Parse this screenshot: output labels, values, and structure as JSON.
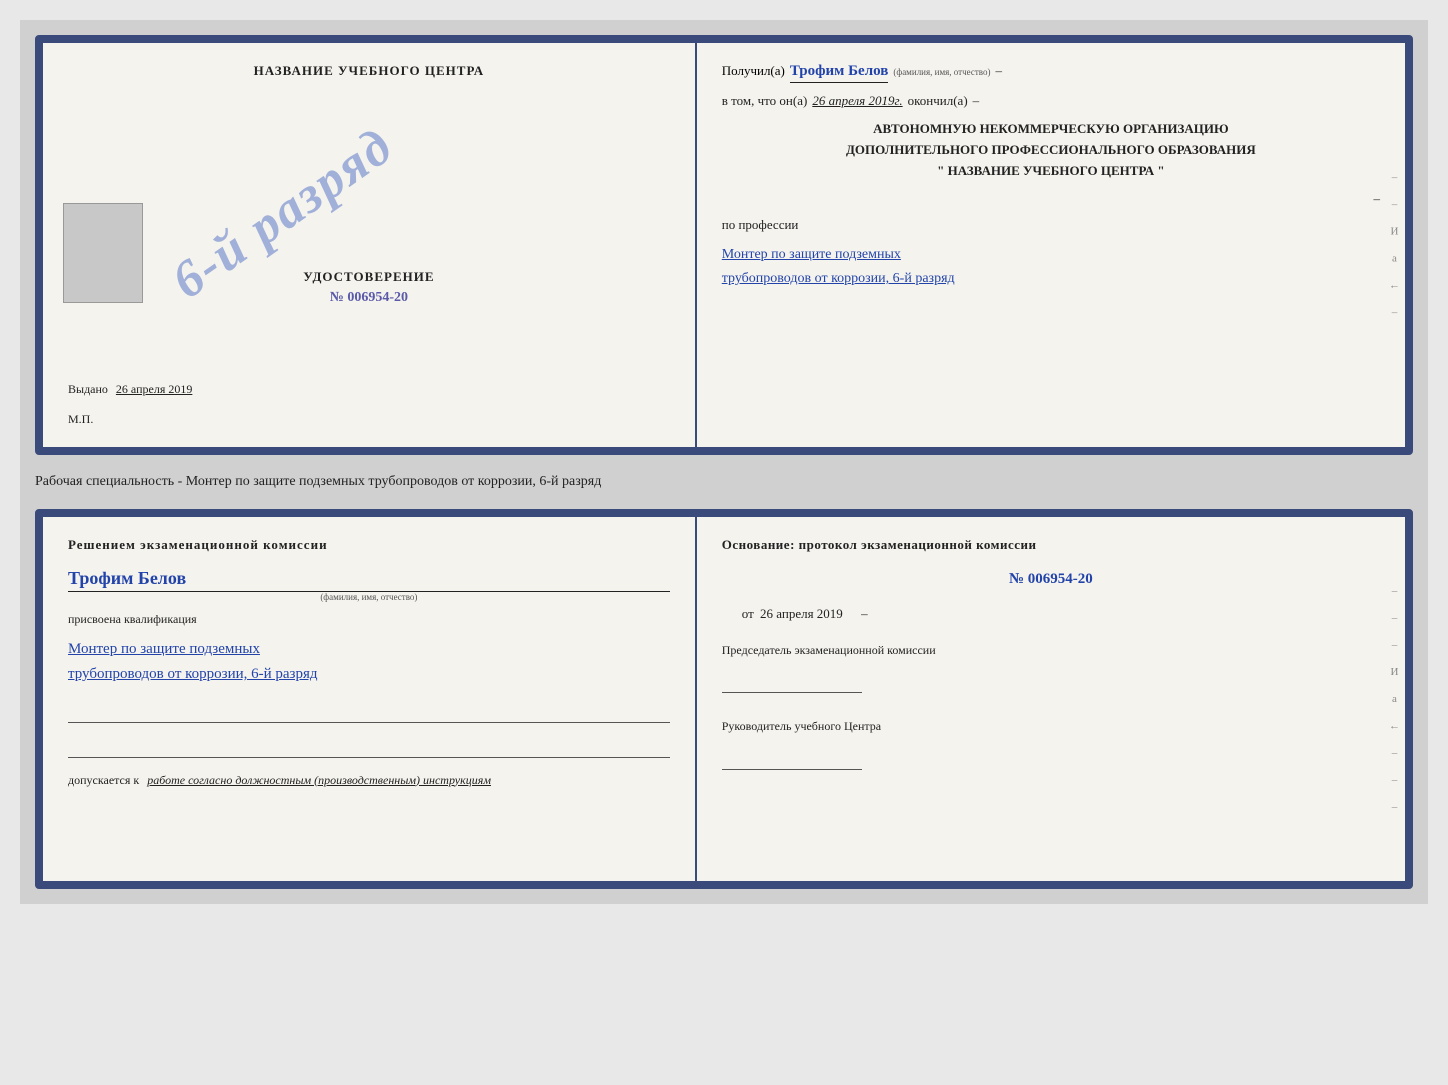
{
  "page": {
    "background": "#d0d0d0"
  },
  "topDoc": {
    "left": {
      "title": "НАЗВАНИЕ УЧЕБНОГО ЦЕНТРА",
      "photoAlt": "photo",
      "certLabel": "УДОСТОВЕРЕНИЕ",
      "certNumber": "№ 006954-20",
      "stampText": "6-й разряд",
      "issuedLabel": "Выдано",
      "issuedDate": "26 апреля 2019",
      "mpLabel": "М.П."
    },
    "right": {
      "receivedLabel": "Получил(а)",
      "recipientName": "Трофим Белов",
      "fioLabel": "(фамилия, имя, отчество)",
      "dash1": "–",
      "inThatLabel": "в том, что он(а)",
      "date": "26 апреля 2019г.",
      "finishedLabel": "окончил(а)",
      "dash2": "–",
      "orgText1": "АВТОНОМНУЮ НЕКОММЕРЧЕСКУЮ ОРГАНИЗАЦИЮ",
      "orgText2": "ДОПОЛНИТЕЛЬНОГО ПРОФЕССИОНАЛЬНОГО ОБРАЗОВАНИЯ",
      "orgText3": "\"  НАЗВАНИЕ УЧЕБНОГО ЦЕНТРА  \"",
      "dash3": "–",
      "professionLabel": "по профессии",
      "professionLine1": "Монтер по защите подземных",
      "professionLine2": "трубопроводов от коррозии, 6-й разряд",
      "edgeChars": [
        "–",
        "–",
        "И",
        "а",
        "←",
        "–"
      ]
    }
  },
  "specialtyLine": {
    "text": "Рабочая специальность - Монтер по защите подземных трубопроводов от коррозии, 6-й разряд"
  },
  "bottomDoc": {
    "left": {
      "commissionTitle": "Решением экзаменационной  комиссии",
      "personName": "Трофим Белов",
      "fioLabel": "(фамилия, имя, отчество)",
      "assignedLabel": "присвоена квалификация",
      "qualLine1": "Монтер по защите подземных",
      "qualLine2": "трубопроводов от коррозии, 6-й разряд",
      "allowedPrefix": "допускается к",
      "allowedItalic": "работе согласно должностным (производственным) инструкциям"
    },
    "right": {
      "basisTitle": "Основание: протокол экзаменационной  комиссии",
      "protocolNumber": "№  006954-20",
      "datePrefix": "от",
      "date": "26 апреля 2019",
      "chairmanTitle": "Председатель экзаменационной комиссии",
      "directorTitle": "Руководитель учебного Центра",
      "edgeChars": [
        "–",
        "–",
        "–",
        "И",
        "а",
        "←",
        "–",
        "–",
        "–"
      ]
    }
  }
}
